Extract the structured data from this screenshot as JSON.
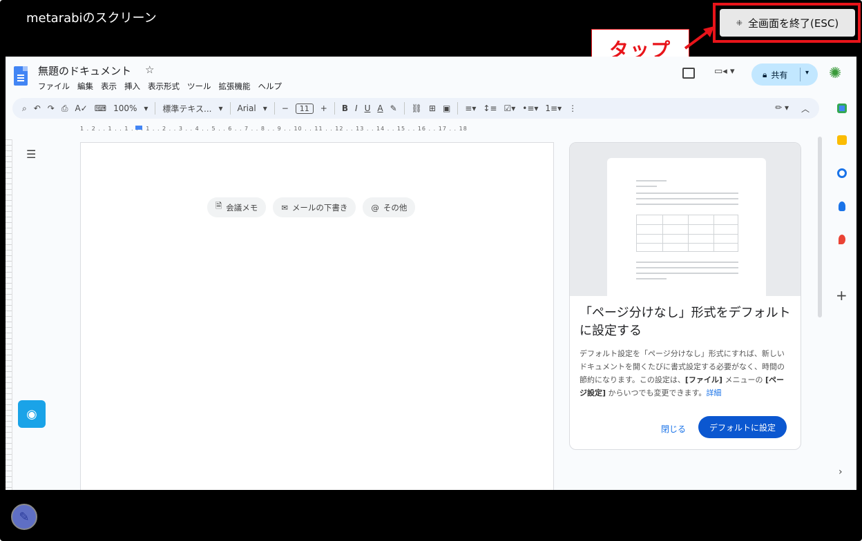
{
  "screen_share": {
    "title": "metarabiのスクリーン",
    "exit_label": "全画面を終了(ESC)",
    "exit_icon": "collapse-icon"
  },
  "annotation": {
    "tap_label": "タップ",
    "color": "#e8141a"
  },
  "doc": {
    "title": "無題のドキュメント",
    "menu": [
      "ファイル",
      "編集",
      "表示",
      "挿入",
      "表示形式",
      "ツール",
      "拡張機能",
      "ヘルプ"
    ],
    "share_label": "共有"
  },
  "toolbar": {
    "zoom": "100%",
    "style": "標準テキス...",
    "font": "Arial",
    "font_size": "11"
  },
  "ruler_text": "1 . 2 . . 1 . . 1 . . . 1 . . 2 . . 3 . . 4 . . 5 . . 6 . . 7 . . 8 . . 9 . . 10 . . 11 . . 12 . . 13 . . 14 . . 15 . . 16 . . 17 . . 18",
  "chips": [
    {
      "label": "会議メモ",
      "icon": "doc-icon"
    },
    {
      "label": "メールの下書き",
      "icon": "mail-icon"
    },
    {
      "label": "その他",
      "icon": "at-icon"
    }
  ],
  "panel": {
    "title": "「ページ分けなし」形式をデフォルトに設定する",
    "body_1": "デフォルト設定を「ページ分けなし」形式にすれば、新しいドキュメントを開くたびに書式設定する必要がなく、時間の節約になります。この設定は、",
    "body_bold_1": "[ファイル]",
    "body_2": " メニューの ",
    "body_bold_2": "[ページ設定]",
    "body_3": " からいつでも変更できます。",
    "body_link": "詳細",
    "close_label": "閉じる",
    "default_label": "デフォルトに設定"
  },
  "colors": {
    "accent_blue": "#0b57d0",
    "share_bg": "#c2e7ff",
    "record_button": "#1aa3e8"
  }
}
